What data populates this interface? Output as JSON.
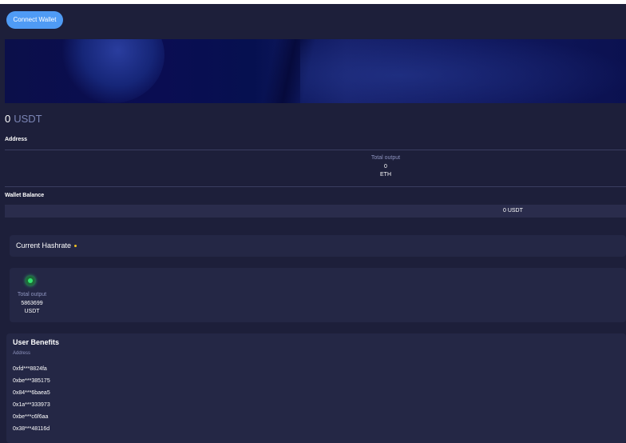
{
  "header": {
    "connect_label": "Connect Wallet"
  },
  "banner": {
    "description_icon": "abstract-blue-banner"
  },
  "balance": {
    "amount": "0",
    "unit": "USDT"
  },
  "address_section": {
    "label": "Address"
  },
  "total_output_section": {
    "label": "Total output",
    "value": "0",
    "unit": "ETH"
  },
  "wallet_balance": {
    "label": "Wallet Balance",
    "value": "0 USDT"
  },
  "hashrate": {
    "title": "Current Hashrate",
    "indicator_color": "#f0c020"
  },
  "output_card": {
    "status_icon": "green-status-dot",
    "label": "Total output",
    "value": "5863699",
    "unit": "USDT"
  },
  "benefits": {
    "title": "User Benefits",
    "subtitle": "Address",
    "addresses": [
      "0xfd***8824fa",
      "0xbe***385175",
      "0x84***6baea5",
      "0x1a***333973",
      "0xbe***c6f6aa",
      "0x38***48116d"
    ]
  },
  "colors": {
    "background": "#1d1f3a",
    "card": "#242745",
    "accent": "#4f9bf5",
    "muted_text": "#8e94bf"
  }
}
